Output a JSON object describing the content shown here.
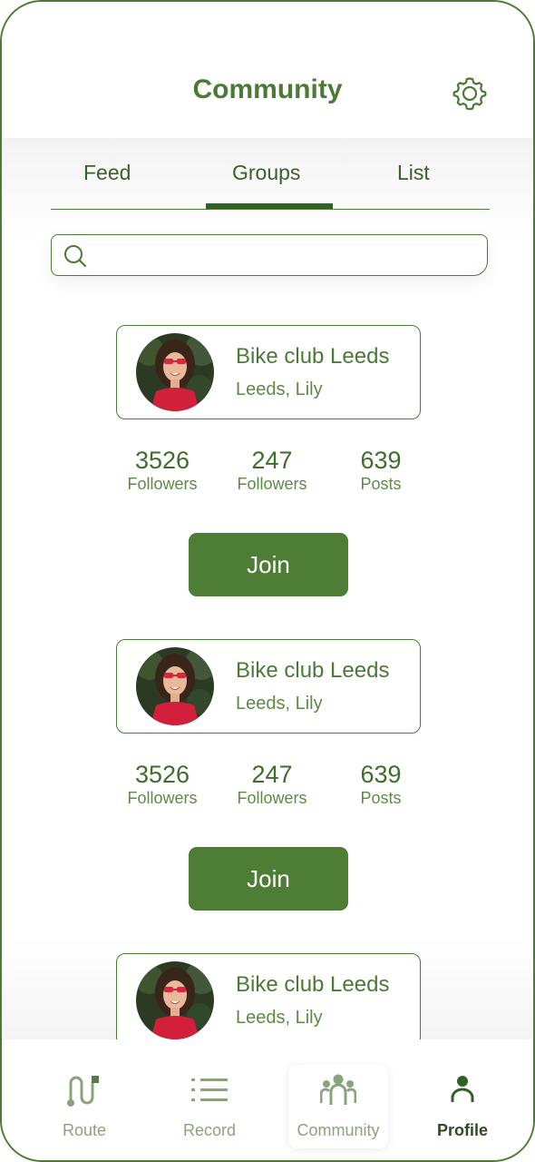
{
  "header": {
    "title": "Community",
    "settings_icon": "gear-icon"
  },
  "tabs": [
    {
      "label": "Feed"
    },
    {
      "label": "Groups",
      "selected": true
    },
    {
      "label": "List"
    }
  ],
  "search": {
    "placeholder": "",
    "icon": "search-icon"
  },
  "groups": [
    {
      "name": "Bike club Leeds",
      "subtitle": "Leeds, Lily",
      "stats": [
        {
          "value": "3526",
          "label": "Followers"
        },
        {
          "value": "247",
          "label": "Followers"
        },
        {
          "value": "639",
          "label": "Posts"
        }
      ],
      "join_label": "Join"
    },
    {
      "name": "Bike club Leeds",
      "subtitle": "Leeds, Lily",
      "stats": [
        {
          "value": "3526",
          "label": "Followers"
        },
        {
          "value": "247",
          "label": "Followers"
        },
        {
          "value": "639",
          "label": "Posts"
        }
      ],
      "join_label": "Join"
    },
    {
      "name": "Bike club Leeds",
      "subtitle": "Leeds, Lily"
    }
  ],
  "nav": [
    {
      "label": "Route",
      "icon": "route-icon"
    },
    {
      "label": "Record",
      "icon": "list-icon"
    },
    {
      "label": "Community",
      "icon": "community-icon",
      "active": true
    },
    {
      "label": "Profile",
      "icon": "profile-icon"
    }
  ],
  "colors": {
    "primary": "#4e7d36",
    "text": "#4a7a35",
    "tab_indicator": "#335f28"
  }
}
